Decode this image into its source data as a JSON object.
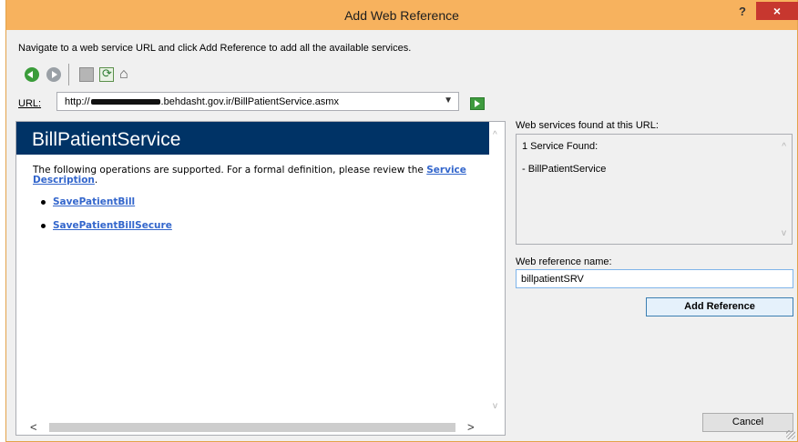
{
  "window": {
    "title": "Add Web Reference",
    "help_label": "?",
    "close_label": "×"
  },
  "instruction": "Navigate to a web service URL and click Add Reference to add all the available services.",
  "url": {
    "label": "URL:",
    "prefix": "http://",
    "suffix": ".behdasht.gov.ir/BillPatientService.asmx",
    "dropdown_glyph": "▼"
  },
  "toolbar": {
    "icons": [
      "back-icon",
      "forward-icon",
      "stop-icon",
      "refresh-icon",
      "home-icon"
    ],
    "home_glyph": "⌂"
  },
  "service_page": {
    "service_name": "BillPatientService",
    "description_text": "The following operations are supported. For a formal definition, please review the",
    "description_link": "Service Description",
    "description_end": ".",
    "operations": [
      "SavePatientBill",
      "SavePatientBillSecure"
    ],
    "header_color": "#003366",
    "link_color": "#3366cc"
  },
  "scrollbars": {
    "up": "^",
    "down": "v",
    "left": "<",
    "right": ">"
  },
  "services_found": {
    "label": "Web services found at this URL:",
    "count_text": "1 Service Found:",
    "items": [
      "- BillPatientService"
    ]
  },
  "reference": {
    "label": "Web reference name:",
    "value": "billpatientSRV"
  },
  "buttons": {
    "add_reference": "Add Reference",
    "cancel": "Cancel"
  },
  "colors": {
    "titlebar": "#f7b25e",
    "close": "#c7372f"
  }
}
